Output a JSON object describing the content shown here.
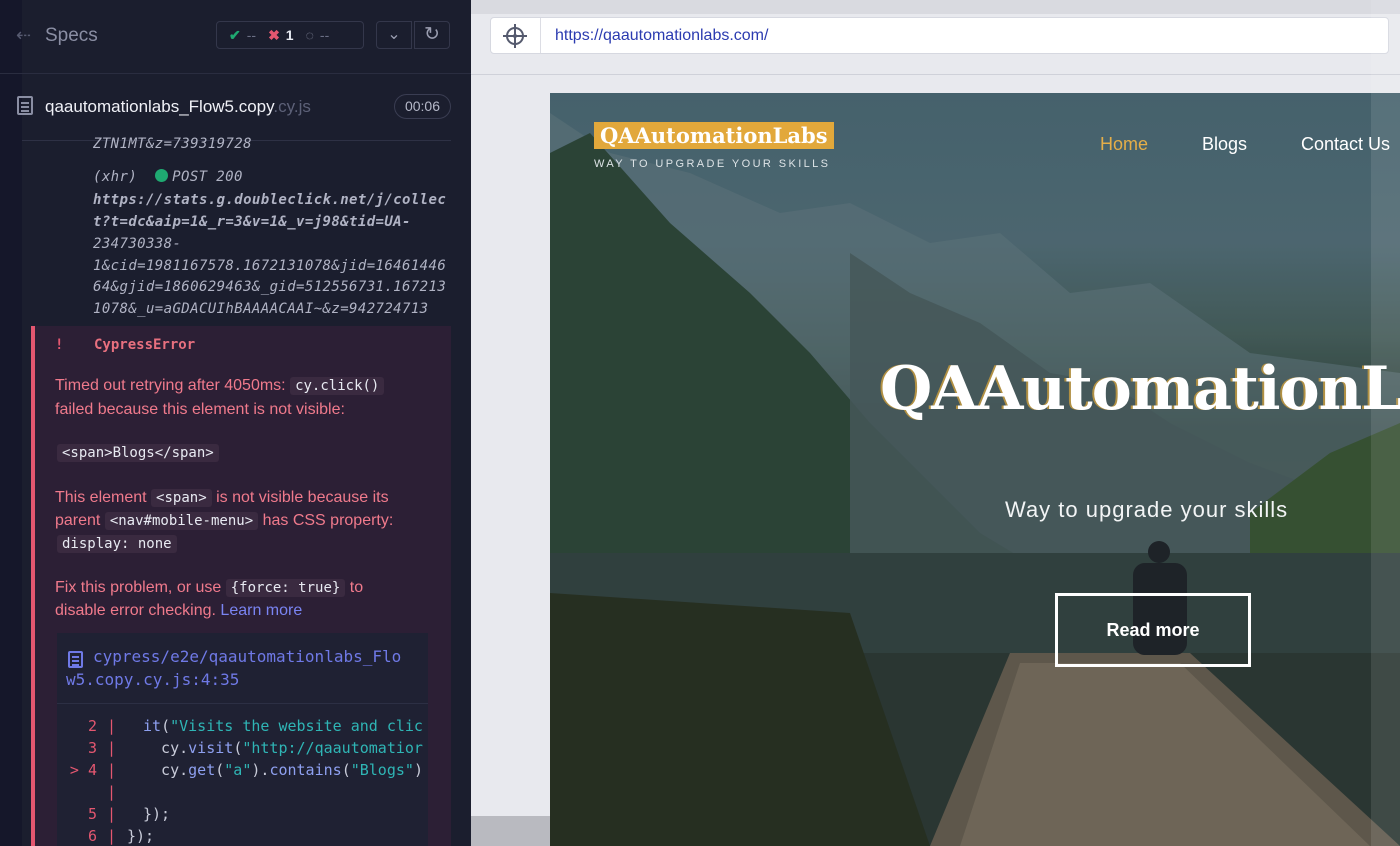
{
  "cypress": {
    "header": {
      "title": "Specs",
      "stats": {
        "passed": "--",
        "failed": "1",
        "pending": "--"
      }
    },
    "spec": {
      "name": "qaautomationlabs_Flow5.copy",
      "ext": ".cy.js",
      "duration": "00:06"
    },
    "log": {
      "prev_tail": "ZTN1MT&z=739319728",
      "xhr_label": "(xhr)",
      "xhr_status": "POST 200",
      "xhr_url_lines": [
        "https://stats.g.doubleclick.net/j/collec",
        "t?t=dc&aip=1&_r=3&v=1&_v=j98&tid=UA-",
        "234730338-",
        "1&cid=1981167578.1672131078&jid=16461446",
        "64&gjid=1860629463&_gid=512556731.167213",
        "1078&_u=aGDACUIhBAAAACAAI~&z=942724713"
      ]
    },
    "error": {
      "bang": "!",
      "name": "CypressError",
      "line1_a": "Timed out retrying after 4050ms:",
      "line1_code": "cy.click()",
      "line2": "failed because this element is not visible:",
      "element_code": "<span>Blogs</span>",
      "p2_a": "This element",
      "p2_code1": "<span>",
      "p2_b": "is not visible because its",
      "p2_c": "parent",
      "p2_code2": "<nav#mobile-menu>",
      "p2_d": "has CSS property:",
      "p2_code3": "display: none",
      "p3_a": "Fix this problem, or use",
      "p3_code": "{force: true}",
      "p3_b": "to",
      "p3_c": "disable error checking.",
      "learn_more": "Learn more"
    },
    "codeframe": {
      "path_line1": "cypress/e2e/qaautomationlabs_Flo",
      "path_line2": "w5.copy.cy.js:4:35",
      "lines": [
        {
          "num": "2",
          "bar": "|",
          "code": "  it(\"Visits the website and clic"
        },
        {
          "num": "3",
          "bar": "|",
          "code": "    cy.visit(\"http://qaautomatior"
        },
        {
          "num": "> 4",
          "bar": "|",
          "code": "    cy.get(\"a\").contains(\"Blogs\")"
        },
        {
          "num": "",
          "bar": "|",
          "code": ""
        },
        {
          "num": "5",
          "bar": "|",
          "code": "  });"
        },
        {
          "num": "6",
          "bar": "|",
          "code": "});"
        }
      ]
    }
  },
  "browser": {
    "url": "https://qaautomationlabs.com/"
  },
  "website": {
    "logo": "QAAutomationLabs",
    "tagline": "WAY TO UPGRADE YOUR SKILLS",
    "nav": [
      "Home",
      "Blogs",
      "Contact Us"
    ],
    "hero_title": "QAAutomationLabs",
    "hero_subtitle": "Way to upgrade your skills",
    "cta": "Read more"
  },
  "colors": {
    "panel_bg": "#1b1e2e",
    "error_red": "#e45770",
    "pass_green": "#1fa971",
    "link_blue": "#2b3bb0",
    "brand_gold": "#e2a83b"
  },
  "icons": {
    "back": "list-collapse-icon",
    "spec_file": "document-icon",
    "url_target": "crosshair-icon",
    "reload": "reload-icon",
    "chevron": "chevron-down-icon"
  }
}
